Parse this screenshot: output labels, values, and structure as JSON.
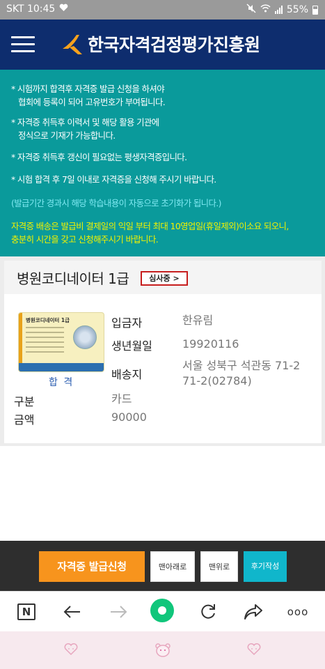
{
  "status_bar": {
    "carrier_time": "SKT 10:45",
    "battery_percent": "55%"
  },
  "header": {
    "title": "한국자격검정평가진흥원",
    "logo_letter": "K"
  },
  "notice": {
    "lines": [
      "* 시험까지 합격후 자격증 발급 신청을 하셔야\n   협회에 등록이 되어 고유번호가 부여됩니다.",
      "* 자격증 취득후 이력서 및 해당 활용 기관에\n   정식으로 기재가 가능합니다.",
      "* 자격증 취득후 갱신이 필요없는 평생자격증입니다.",
      "* 시험 합격 후 7일 이내로 자격증을 신청해 주시기 바랍니다."
    ],
    "period_note": "(발급기간 경과시 해당 학습내용이 자동으로 초기화가 됩니다.)",
    "delivery_note": "자격증 배송은 발급비 결제일의 익일 부터 최대 10영업일(휴일제외)이소요 되오니,\n충분히 시간을 갖고 신청해주시기 바랍니다."
  },
  "certificate": {
    "course_name": "병원코디네이터 1급",
    "status": "심사중 >",
    "image_title": "병원코디네이터 1급",
    "result": "합 격",
    "fields": {
      "payer_label": "입금자",
      "payer_value": "한유림",
      "birth_label": "생년월일",
      "birth_value": "19920116",
      "address_label": "배송지",
      "address_value_line1": "서울 성북구 석관동 71-2",
      "address_value_line2": "71-2(02784)",
      "type_label": "구분",
      "type_value": "카드",
      "amount_label": "금액",
      "amount_value": "90000"
    }
  },
  "action_bar": {
    "apply_label": "자격증 발급신청",
    "bottom_label": "맨아래로",
    "top_label": "맨위로",
    "review_label": "후기작성"
  },
  "browser_nav": {
    "home_letter": "N",
    "more_label": "ooo"
  },
  "colors": {
    "header_bg": "#0e2d6e",
    "notice_bg": "#0a9a9b",
    "apply_button": "#f7941d",
    "review_button": "#10b6cb",
    "status_badge_border": "#c71e1e"
  }
}
